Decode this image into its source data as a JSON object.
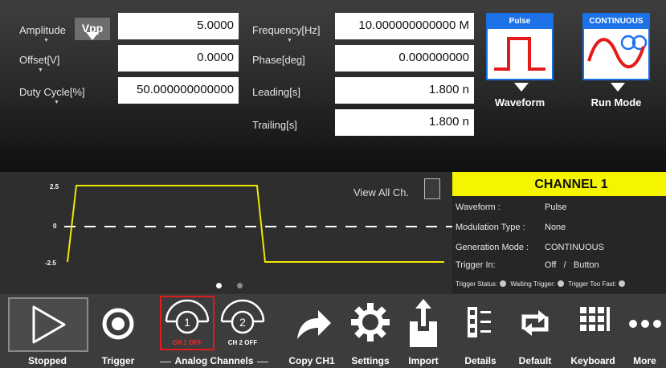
{
  "params": {
    "amplitude": {
      "label": "Amplitude",
      "unit_button": "Vpp",
      "value": "5.0000"
    },
    "offset": {
      "label": "Offset[V]",
      "value": "0.0000"
    },
    "duty_cycle": {
      "label": "Duty Cycle[%]",
      "value": "50.000000000000"
    },
    "frequency": {
      "label": "Frequency[Hz]",
      "value": "10.000000000000 M"
    },
    "phase": {
      "label": "Phase[deg]",
      "value": "0.000000000"
    },
    "leading": {
      "label": "Leading[s]",
      "value": "1.800 n"
    },
    "trailing": {
      "label": "Trailing[s]",
      "value": "1.800 n"
    }
  },
  "tiles": {
    "waveform": {
      "header": "Pulse",
      "caption": "Waveform"
    },
    "run_mode": {
      "header": "CONTINUOUS",
      "caption": "Run Mode"
    }
  },
  "graph": {
    "y_ticks": [
      "2.5",
      "0",
      "-2.5"
    ],
    "view_all_label": "View All Ch.",
    "trace_color": "#f2e600",
    "page_dots": {
      "count": 2,
      "active": 1
    }
  },
  "channel": {
    "title": "CHANNEL 1",
    "rows": [
      {
        "label": "Waveform :",
        "value": "Pulse"
      },
      {
        "label": "Modulation Type :",
        "value": "None"
      },
      {
        "label": "Generation Mode :",
        "value": "CONTINUOUS"
      },
      {
        "label": "Trigger In:",
        "value": "Off   /   Button"
      }
    ],
    "trigger_status": {
      "label": "Trigger Status:",
      "waiting": "Waiting Trigger:",
      "too_fast": "Trigger Too Fast:"
    }
  },
  "toolbar": {
    "stopped": "Stopped",
    "trigger": "Trigger",
    "analog_channels": "Analog Channels",
    "ch1_number": "1",
    "ch1_status": "CH 1 OFF",
    "ch2_number": "2",
    "ch2_status": "CH 2 OFF",
    "copy": "Copy CH1",
    "settings": "Settings",
    "import": "Import",
    "details": "Details",
    "default": "Default",
    "keyboard": "Keyboard",
    "more": "More"
  },
  "colors": {
    "accent_blue": "#1d72e8",
    "waveform_red": "#e31b1b",
    "channel_yellow": "#f5f500"
  }
}
